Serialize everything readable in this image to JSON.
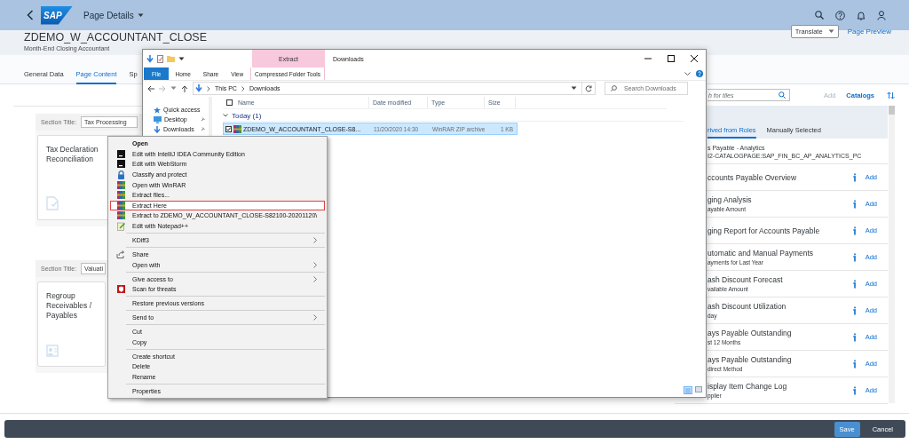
{
  "shell": {
    "logo": "SAP",
    "title": "Page Details"
  },
  "header": {
    "title": "ZDEMO_W_ACCOUNTANT_CLOSE",
    "subtitle": "Month-End Closing Accountant",
    "translate": "Translate",
    "preview": "Page Preview"
  },
  "tabs": [
    {
      "label": "General Data",
      "selected": false
    },
    {
      "label": "Page Content",
      "selected": true
    },
    {
      "label": "Sp",
      "selected": false
    }
  ],
  "sections": [
    {
      "label": "Section Title:",
      "value": "Tax Processing",
      "tile": {
        "title": "Tax Declaration Reconciliation"
      }
    },
    {
      "label": "Section Title:",
      "value": "Valuati",
      "tile": {
        "title": "Regroup Receivables / Payables"
      }
    }
  ],
  "catalog": {
    "search_placeholder": "h for tiles",
    "add": {
      "label": "Add",
      "disabled": true
    },
    "catalogs": "Catalogs",
    "tabs": [
      {
        "label": "rived from Roles",
        "selected": true
      },
      {
        "label": "Manually Selected",
        "selected": false
      }
    ],
    "group": {
      "title": "s Payable - Analytics",
      "id": "I2-CATALOGPAGE:SAP_FIN_BC_AP_ANALYTICS_PC"
    },
    "tiles": [
      {
        "title": "ccounts Payable Overview",
        "action": "Add"
      },
      {
        "title": "ging Analysis",
        "subtitle": "ayable Amount",
        "action": "Add"
      },
      {
        "title": "ging Report for Accounts Payable",
        "action": "Add"
      },
      {
        "title": "utomatic and Manual Payments",
        "subtitle": "ayments for Last Year",
        "action": "Add"
      },
      {
        "title": "ash Discount Forecast",
        "subtitle": "vailable Amount",
        "action": "Add"
      },
      {
        "title": "ash Discount Utilization",
        "subtitle": "day",
        "action": "Add"
      },
      {
        "title": "ays Payable Outstanding",
        "subtitle": "st 12 Months",
        "action": "Add"
      },
      {
        "title": "ays Payable Outstanding",
        "subtitle": "direct Method",
        "action": "Add"
      },
      {
        "title": "isplay Item Change Log",
        "subtitle": "pplier",
        "action": "Add"
      }
    ]
  },
  "explorer": {
    "title": "Downloads",
    "context_tab": "Extract",
    "context_group": "Compressed Folder Tools",
    "ribbon_tabs": [
      {
        "label": "File",
        "kind": "file"
      },
      {
        "label": "Home",
        "kind": "tab"
      },
      {
        "label": "Share",
        "kind": "tab"
      },
      {
        "label": "View",
        "kind": "tab"
      }
    ],
    "path": [
      "This PC",
      "Downloads"
    ],
    "search_placeholder": "Search Downloads",
    "nav": [
      {
        "label": "Quick access",
        "pinned": false
      },
      {
        "label": "Desktop",
        "pinned": true
      },
      {
        "label": "Downloads",
        "pinned": true
      }
    ],
    "select_all": {
      "checked": false
    },
    "columns": [
      "Name",
      "Date modified",
      "Type",
      "Size"
    ],
    "group": "Today (1)",
    "files": [
      {
        "name": "ZDEMO_W_ACCOUNTANT_CLOSE-S8...",
        "date": "11/20/2020 14:30",
        "type": "WinRAR ZIP archive",
        "size": "1 KB",
        "selected": true,
        "checked": true
      }
    ]
  },
  "context_menu": {
    "groups": [
      [
        {
          "label": "Open",
          "kind": "plain",
          "default": true,
          "highlighted": false,
          "submenu": false
        },
        {
          "label": "Edit with IntelliJ IDEA Community Edition",
          "kind": "ide",
          "default": false,
          "highlighted": false,
          "submenu": false
        },
        {
          "label": "Edit with WebStorm",
          "kind": "ide",
          "default": false,
          "highlighted": false,
          "submenu": false
        },
        {
          "label": "Classify and protect",
          "kind": "lock",
          "default": false,
          "highlighted": false,
          "submenu": false
        },
        {
          "label": "Open with WinRAR",
          "kind": "archive",
          "default": false,
          "highlighted": false,
          "submenu": false
        },
        {
          "label": "Extract files...",
          "kind": "archive",
          "default": false,
          "highlighted": false,
          "submenu": false
        },
        {
          "label": "Extract Here",
          "kind": "archive",
          "default": false,
          "highlighted": true,
          "submenu": false
        },
        {
          "label": "Extract to ZDEMO_W_ACCOUNTANT_CLOSE-S82100-20201120\\",
          "kind": "archive",
          "default": false,
          "highlighted": false,
          "submenu": false
        },
        {
          "label": "Edit with Notepad++",
          "kind": "notepad",
          "default": false,
          "highlighted": false,
          "submenu": false
        }
      ],
      [
        {
          "label": "KDiff3",
          "kind": "plain",
          "default": false,
          "highlighted": false,
          "submenu": true
        }
      ],
      [
        {
          "label": "Share",
          "kind": "share",
          "default": false,
          "highlighted": false,
          "submenu": false
        },
        {
          "label": "Open with",
          "kind": "plain",
          "default": false,
          "highlighted": false,
          "submenu": true
        }
      ],
      [
        {
          "label": "Give access to",
          "kind": "plain",
          "default": false,
          "highlighted": false,
          "submenu": true
        },
        {
          "label": "Scan for threats",
          "kind": "shield",
          "default": false,
          "highlighted": false,
          "submenu": false
        }
      ],
      [
        {
          "label": "Restore previous versions",
          "kind": "plain",
          "default": false,
          "highlighted": false,
          "submenu": false
        }
      ],
      [
        {
          "label": "Send to",
          "kind": "plain",
          "default": false,
          "highlighted": false,
          "submenu": true
        }
      ],
      [
        {
          "label": "Cut",
          "kind": "plain",
          "default": false,
          "highlighted": false,
          "submenu": false
        },
        {
          "label": "Copy",
          "kind": "plain",
          "default": false,
          "highlighted": false,
          "submenu": false
        }
      ],
      [
        {
          "label": "Create shortcut",
          "kind": "plain",
          "default": false,
          "highlighted": false,
          "submenu": false
        },
        {
          "label": "Delete",
          "kind": "plain",
          "default": false,
          "highlighted": false,
          "submenu": false
        },
        {
          "label": "Rename",
          "kind": "plain",
          "default": false,
          "highlighted": false,
          "submenu": false
        }
      ],
      [
        {
          "label": "Properties",
          "kind": "plain",
          "default": false,
          "highlighted": false,
          "submenu": false
        }
      ]
    ]
  },
  "footer": {
    "buttons": [
      {
        "label": "Save",
        "kind": "primary"
      },
      {
        "label": "Cancel",
        "kind": "plain"
      }
    ]
  }
}
